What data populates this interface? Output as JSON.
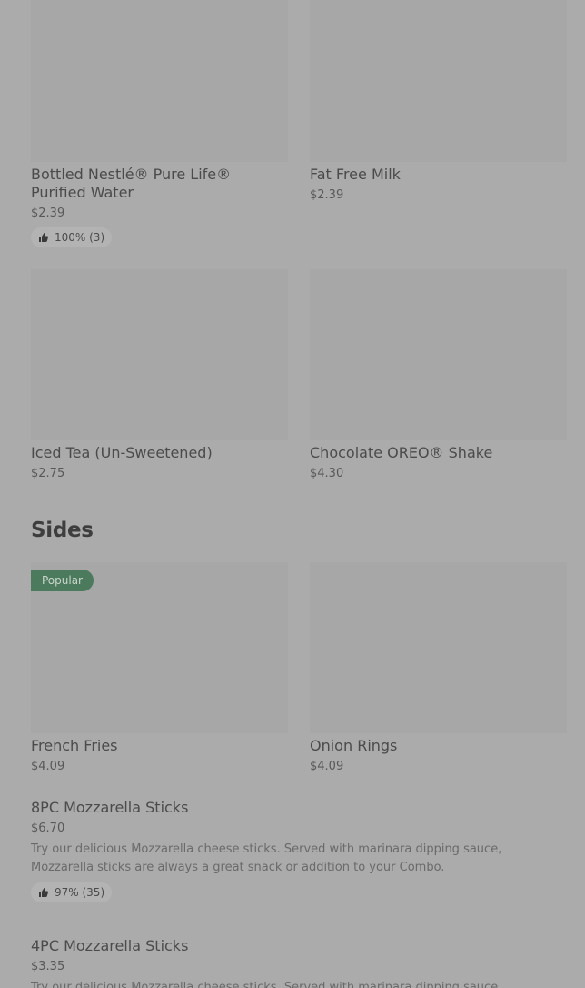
{
  "drinks": [
    {
      "name": "Bottled Nestlé® Pure Life® Purified Water",
      "price": "$2.39",
      "rating": "100% (3)"
    },
    {
      "name": "Fat Free Milk",
      "price": "$2.39"
    },
    {
      "name": "Iced Tea (Un-Sweetened)",
      "price": "$2.75"
    },
    {
      "name": "Chocolate OREO® Shake",
      "price": "$4.30"
    }
  ],
  "sides_section": {
    "title": "Sides",
    "popular_badge": "Popular",
    "cards": [
      {
        "name": "French Fries",
        "price": "$4.09"
      },
      {
        "name": "Onion Rings",
        "price": "$4.09"
      }
    ],
    "list": [
      {
        "name": "8PC Mozzarella Sticks",
        "price": "$6.70",
        "description": "Try our delicious Mozzarella cheese sticks. Served with marinara dipping sauce, Mozzarella sticks are always a great snack or addition to your Combo.",
        "rating": "97% (35)"
      },
      {
        "name": "4PC Mozzarella Sticks",
        "price": "$3.35",
        "description": "Try our delicious Mozzarella cheese sticks. Served with marinara dipping sauce,"
      }
    ]
  },
  "colors": {
    "overlay_bg": "#ababab",
    "image_placeholder": "#a7a7a7",
    "popular_badge": "#4c7a5c"
  },
  "icons": {
    "rating": "thumbs-up-icon"
  }
}
